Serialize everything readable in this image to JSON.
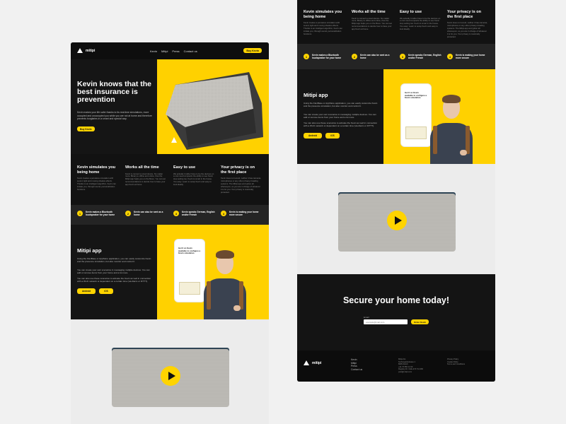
{
  "nav": {
    "logo": "mitipi",
    "links": [
      "Kevin",
      "Mitipi",
      "Press",
      "Contact us"
    ],
    "button": "Buy Kevin"
  },
  "hero": {
    "title": "Kevin knows that the best insurance is prevention",
    "subtitle": "Kevin makes your life safer thanks to its real-time simulations, more occupied and unoccupied you while you are not at home and therefore prevents burglaries in a smart and special way.",
    "button": "Buy Kevin"
  },
  "features": [
    {
      "title": "Kevin simulates you being home",
      "body": "Kevin creates a pervasive simulation with sound, light and moving shadow effects. Thanks to an intelligent algorithm, Kevin can imitate you, through sound, personalization functions."
    },
    {
      "title": "Works all the time",
      "body": "Kevin is connect a smart device. No matter more. Binary to offline and online, thus the Mitipi app helps you on the Move. You can set recommendations to decide how to have your app Kevin at home."
    },
    {
      "title": "Easy to use",
      "body": "We actually it rather have to be the devices on a cost need compacts the ability to see Kevin stop setting too. Kevin is smart in the house. You easy: Learn to setup Kevin and easy to look ideally."
    },
    {
      "title": "Your privacy is on the first place",
      "body": "Kevin does not record, neither it has cameras, microphones or any other privacy-invading systems. The Mitipi app encryption all whereupon, so you are in charge of whatever it is for you. Your privacy is maximally protected."
    }
  ],
  "steps": [
    {
      "icon": "1",
      "text": "Kevin makes a Bluetooth loudspeaker for your home"
    },
    {
      "icon": "2",
      "text": "Kevin can also be sent as a home"
    },
    {
      "icon": "3",
      "text": "Kevin speaks German, English and/or French"
    },
    {
      "icon": "4",
      "text": "Kevin is making your home more secure"
    }
  ],
  "app": {
    "title": "Mitipi app",
    "p1": "Using the FlexBase or AppStore application, you can easily customize Kevin and the presence simulation, but also monitor and control it.",
    "p2": "You can create your own scenarios in messaging multiple devices. You can add or remove items from your home and a lot more.",
    "p3": "You can also use these scenarios to activate the Kevin as well in connection with a Wi-Fi network or dependent on a certain time (via Alarm or IFTTT).",
    "buttons": [
      "Android",
      "iOS"
    ],
    "phone_text": "Get It on Kevin available to configure a Kevin simulation."
  },
  "video": {
    "play_icon": "play-icon"
  },
  "cta": {
    "title": "Secure your home today!",
    "email_label": "Email",
    "email_placeholder": "example@mail.com",
    "button": "Order Kevin"
  },
  "footer": {
    "logo": "mitipi",
    "links": [
      "Kevin",
      "Mitipi",
      "Press",
      "Contact us"
    ],
    "address": [
      "Mitipi AG",
      "Technoparkstrasse 1",
      "8005 Zürich",
      "+41 76 550 14 30",
      "Registry-Nr. CHE-274.711.382",
      "post@mitipi.com"
    ],
    "legal": [
      "Privacy Policy",
      "Cookie Policy",
      "Terms and Conditions"
    ]
  },
  "colors": {
    "accent": "#ffd400",
    "dark": "#151515",
    "light": "#ececec"
  }
}
